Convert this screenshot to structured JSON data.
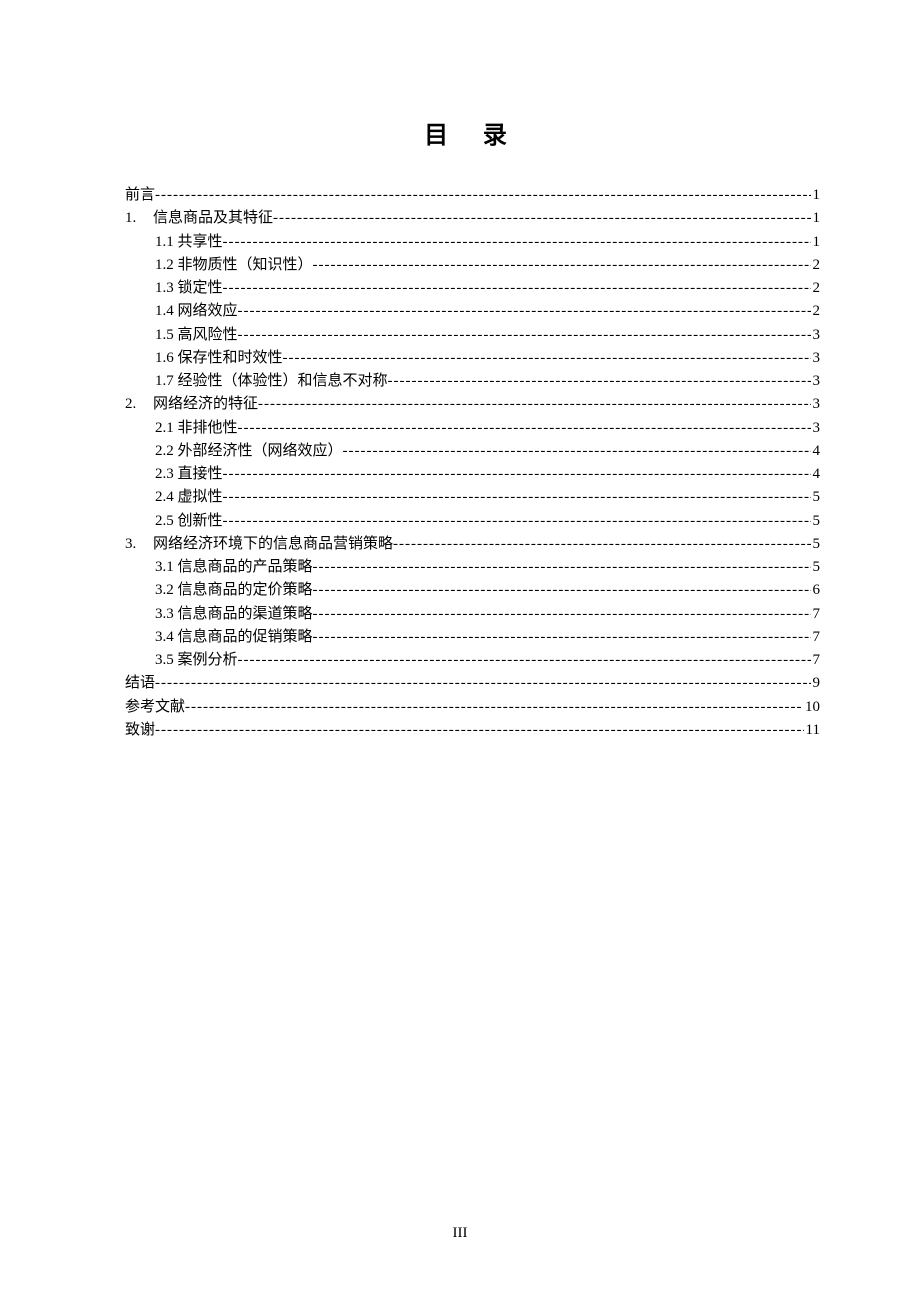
{
  "title": "目 录",
  "footer_page": "III",
  "toc": [
    {
      "level": 0,
      "num": "",
      "label": "前言",
      "space_after": true,
      "page": "1"
    },
    {
      "level": 1,
      "num": "1.",
      "label": "信息商品及其特征",
      "space_after": true,
      "page": "1"
    },
    {
      "level": 2,
      "num": "",
      "label": "1.1 共享性",
      "space_after": false,
      "page": "1"
    },
    {
      "level": 2,
      "num": "",
      "label": "1.2 非物质性（知识性）",
      "space_after": false,
      "page": "2"
    },
    {
      "level": 2,
      "num": "",
      "label": "1.3 锁定性",
      "space_after": false,
      "page": "2"
    },
    {
      "level": 2,
      "num": "",
      "label": "1.4 网络效应",
      "space_after": false,
      "page": "2"
    },
    {
      "level": 2,
      "num": "",
      "label": "1.5 高风险性",
      "space_after": false,
      "page": "3"
    },
    {
      "level": 2,
      "num": "",
      "label": "1.6 保存性和时效性",
      "space_after": false,
      "page": "3"
    },
    {
      "level": 2,
      "num": "",
      "label": "1.7 经验性（体验性）和信息不对称",
      "space_after": false,
      "page": "3"
    },
    {
      "level": 1,
      "num": "2.",
      "label": "网络经济的特征",
      "space_after": true,
      "page": "3"
    },
    {
      "level": 2,
      "num": "",
      "label": "2.1 非排他性",
      "space_after": false,
      "page": "3"
    },
    {
      "level": 2,
      "num": "",
      "label": "2.2 外部经济性（网络效应）",
      "space_after": false,
      "page": "4"
    },
    {
      "level": 2,
      "num": "",
      "label": "2.3 直接性",
      "space_after": false,
      "page": "4"
    },
    {
      "level": 2,
      "num": "",
      "label": "2.4 虚拟性",
      "space_after": false,
      "page": "5"
    },
    {
      "level": 2,
      "num": "",
      "label": "2.5 创新性",
      "space_after": false,
      "page": "5"
    },
    {
      "level": 1,
      "num": "3.",
      "label": "网络经济环境下的信息商品营销策略",
      "space_after": true,
      "page": "5"
    },
    {
      "level": 2,
      "num": "",
      "label": "3.1 信息商品的产品策略",
      "space_after": false,
      "page": "5"
    },
    {
      "level": 2,
      "num": "",
      "label": "3.2 信息商品的定价策略",
      "space_after": false,
      "page": "6"
    },
    {
      "level": 2,
      "num": "",
      "label": "3.3 信息商品的渠道策略",
      "space_after": false,
      "page": "7"
    },
    {
      "level": 2,
      "num": "",
      "label": "3.4 信息商品的促销策略",
      "space_after": false,
      "page": "7"
    },
    {
      "level": 2,
      "num": "",
      "label": "3.5  案例分析",
      "space_after": true,
      "page": "7"
    },
    {
      "level": 0,
      "num": "",
      "label": "结语",
      "space_after": true,
      "page": "9"
    },
    {
      "level": 0,
      "num": "",
      "label": "参考文献",
      "space_after": false,
      "page": "10"
    },
    {
      "level": 0,
      "num": "",
      "label": "致谢",
      "space_after": false,
      "page": "11"
    }
  ]
}
